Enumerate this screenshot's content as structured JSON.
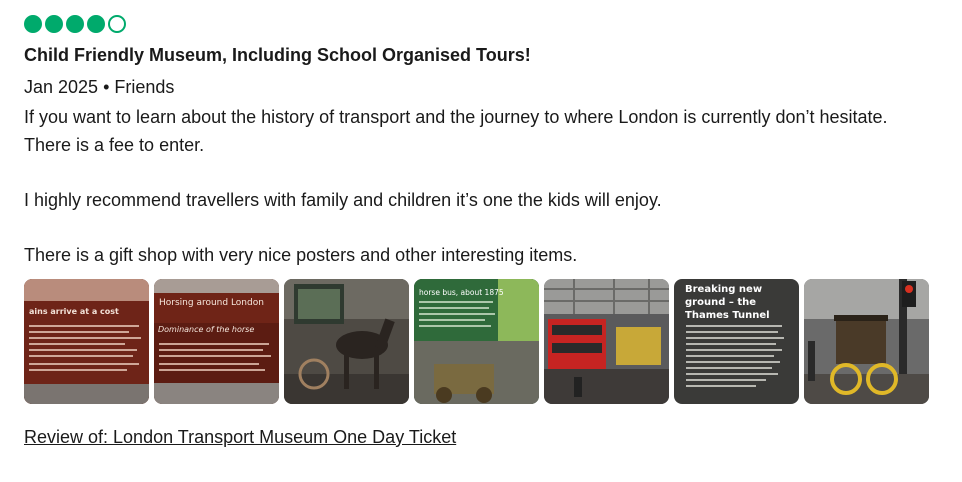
{
  "review": {
    "rating": {
      "value": 4,
      "max": 5,
      "color": "#00aa6c"
    },
    "title": "Child Friendly Museum, Including School Organised Tours!",
    "meta": "Jan 2025 • Friends",
    "body": "If you want to learn about the history of transport and the journey to where London is currently don’t hesitate.\nThere is a fee to enter.\n\nI highly recommend travellers with family and children it’s one the kids will enjoy.\n\nThere is a gift shop with very nice posters and other interesting items.",
    "photos": [
      {
        "caption": "ains arrive at a cost"
      },
      {
        "caption": "Horsing around London",
        "subcaption": "Dominance of the horse"
      },
      {
        "caption": ""
      },
      {
        "caption": "horse bus, about 1875"
      },
      {
        "caption": ""
      },
      {
        "caption": "Breaking new ground – the Thames Tunnel"
      },
      {
        "caption": ""
      }
    ],
    "review_of": "Review of: London Transport Museum One Day Ticket"
  }
}
